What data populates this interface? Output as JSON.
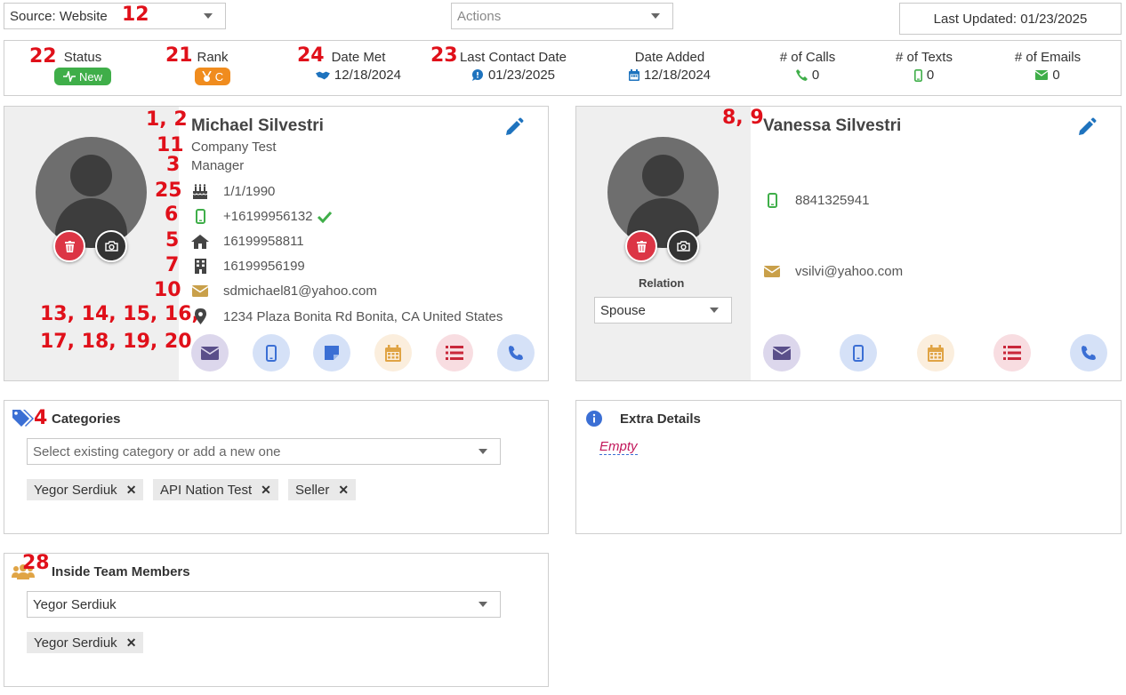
{
  "top": {
    "source_select": "Source: Website",
    "actions_placeholder": "Actions",
    "last_updated": "Last Updated: 01/23/2025"
  },
  "stats": {
    "status": {
      "label": "Status",
      "value": "New"
    },
    "rank": {
      "label": "Rank",
      "value": "C"
    },
    "date_met": {
      "label": "Date Met",
      "value": "12/18/2024"
    },
    "last_contact": {
      "label": "Last Contact Date",
      "value": "01/23/2025"
    },
    "date_added": {
      "label": "Date Added",
      "value": "12/18/2024"
    },
    "calls": {
      "label": "# of Calls",
      "value": "0"
    },
    "texts": {
      "label": "# of Texts",
      "value": "0"
    },
    "emails": {
      "label": "# of Emails",
      "value": "0"
    }
  },
  "contact": {
    "name": "Michael Silvestri",
    "company": "Company Test",
    "title": "Manager",
    "birthday": "1/1/1990",
    "mobile": "+16199956132",
    "home": "16199958811",
    "work": "16199956199",
    "email": "sdmichael81@yahoo.com",
    "address": "1234 Plaza Bonita Rd Bonita, CA United States"
  },
  "spouse": {
    "name": "Vanessa Silvestri",
    "mobile": "8841325941",
    "email": "vsilvi@yahoo.com",
    "relation_label": "Relation",
    "relation_value": "Spouse"
  },
  "categories": {
    "title": "Categories",
    "placeholder": "Select existing category or add a new one",
    "tags": [
      "Yegor Serdiuk",
      "API Nation Test",
      "Seller"
    ]
  },
  "extra": {
    "title": "Extra Details",
    "value": "Empty"
  },
  "team": {
    "title": "Inside Team Members",
    "selected": "Yegor Serdiuk",
    "tags": [
      "Yegor Serdiuk"
    ]
  },
  "annotations": {
    "a12": "12",
    "a22": "22",
    "a21": "21",
    "a24": "24",
    "a23": "23",
    "a1_2": "1, 2",
    "a11": "11",
    "a3": "3",
    "a25": "25",
    "a6": "6",
    "a5": "5",
    "a7": "7",
    "a10": "10",
    "a13_16": "13, 14, 15, 16,",
    "a17_20": "17, 18, 19, 20",
    "a8_9": "8, 9",
    "a4": "4",
    "a28": "28"
  },
  "colors": {
    "status_badge": "#3fae49",
    "rank_badge": "#f08c1e",
    "edit_icon": "#1e73be",
    "delete_button": "#dc3545",
    "camera_button": "#333333",
    "annotation": "#e0101a",
    "empty_text": "#c2185b"
  }
}
